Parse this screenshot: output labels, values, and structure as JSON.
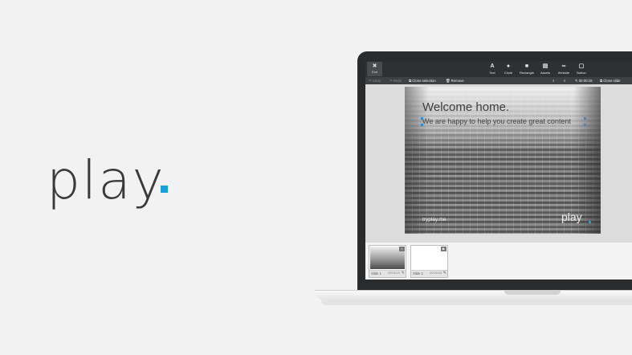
{
  "brand": {
    "name": "play",
    "accent_color": "#1aa0d8"
  },
  "toolbar": {
    "exit": {
      "label": "Exit",
      "icon": "close-icon"
    },
    "tools": [
      {
        "label": "Text",
        "icon": "text-icon"
      },
      {
        "label": "Circle",
        "icon": "circle-icon"
      },
      {
        "label": "Rectangle",
        "icon": "rectangle-icon"
      },
      {
        "label": "Assets",
        "icon": "assets-icon"
      },
      {
        "label": "Website",
        "icon": "link-icon"
      },
      {
        "label": "Button",
        "icon": "button-icon"
      }
    ]
  },
  "subbar": {
    "undo": "Undo",
    "redo": "Redo",
    "clone_selection": "Clone selection",
    "remove": "Remove",
    "duration": "00:00:15",
    "clone_slide": "Clone slide"
  },
  "slide": {
    "title": "Welcome home.",
    "subtitle": "We are happy to help you create great content",
    "footer": "tryplay.me",
    "logo": "play"
  },
  "thumbnails": [
    {
      "name": "Slide 1",
      "time": "00:00:15"
    },
    {
      "name": "Slide 2",
      "time": "00:00:15"
    }
  ]
}
